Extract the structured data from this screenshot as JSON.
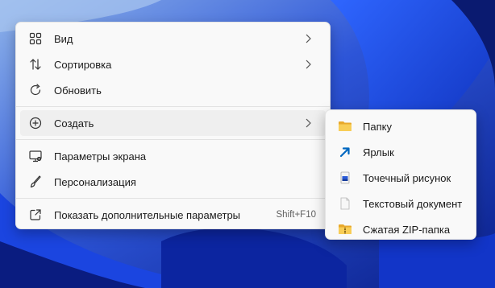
{
  "context_menu": {
    "items": [
      {
        "label": "Вид",
        "icon": "grid-view-icon",
        "has_submenu": true
      },
      {
        "label": "Сортировка",
        "icon": "sort-arrows-icon",
        "has_submenu": true
      },
      {
        "label": "Обновить",
        "icon": "refresh-icon",
        "has_submenu": false
      }
    ],
    "create": {
      "label": "Создать",
      "icon": "plus-circle-icon",
      "has_submenu": true
    },
    "items2": [
      {
        "label": "Параметры экрана",
        "icon": "display-settings-icon"
      },
      {
        "label": "Персонализация",
        "icon": "brush-icon"
      }
    ],
    "more": {
      "label": "Показать дополнительные параметры",
      "shortcut": "Shift+F10",
      "icon": "open-external-icon"
    }
  },
  "submenu": {
    "items": [
      {
        "label": "Папку",
        "icon": "folder-icon"
      },
      {
        "label": "Ярлык",
        "icon": "shortcut-arrow-icon"
      },
      {
        "label": "Точечный рисунок",
        "icon": "bitmap-icon"
      },
      {
        "label": "Текстовый документ",
        "icon": "text-document-icon"
      },
      {
        "label": "Сжатая ZIP-папка",
        "icon": "zip-folder-icon"
      }
    ]
  },
  "colors": {
    "accent": "#0067c0",
    "folder": "#f4c34a",
    "wallpaper": "#0a2aa8"
  }
}
